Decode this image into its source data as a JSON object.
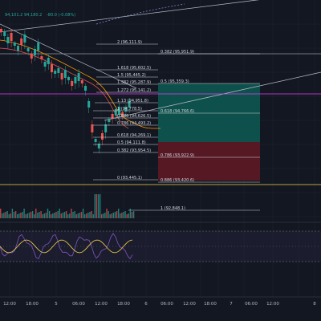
{
  "header": {
    "values": [
      {
        "text": "94,101.2",
        "color": "#26a69a"
      },
      {
        "text": "94,180.2",
        "color": "#26a69a"
      },
      {
        "text": "-80.0 (-0.08%)",
        "color": "#26a69a"
      }
    ]
  },
  "colors": {
    "background": "#131722",
    "up": "#26a69a",
    "down": "#ef5350",
    "fib_line": "#d1d4dc",
    "target_zone": "#0e5a52",
    "stop_zone": "#5e1a25",
    "oscillator": "#7e57c2",
    "oscillator_signal": "#f5d14a"
  },
  "fib_extension": [
    {
      "label": "2 (96,111.9)"
    },
    {
      "label": "1.618 (95,602.5)"
    },
    {
      "label": "1.5 (95,445.2)"
    },
    {
      "label": "1.382 (95,287.9)"
    },
    {
      "label": "1.272 (95,141.2)"
    },
    {
      "label": "1.13 (94,951.8)"
    },
    {
      "label": "1 (94,778.5)"
    },
    {
      "label": "0.886 (94,626.5)"
    },
    {
      "label": "0.786 (94,493.2)"
    },
    {
      "label": "0.618 (94,269.1)"
    },
    {
      "label": "0.5 (94,111.8)"
    },
    {
      "label": "0.382 (93,954.5)"
    },
    {
      "label": "0 (93,445.1)"
    },
    {
      "label": "1 (92,848.1)"
    }
  ],
  "fib_retracement": [
    {
      "label": "0.382 (95,951.9)"
    },
    {
      "label": "0.5 (95,359.3)"
    },
    {
      "label": "0.618 (94,766.6)"
    },
    {
      "label": "0.786 (93,922.9)"
    },
    {
      "label": "0.886 (93,420.6)"
    }
  ],
  "time_axis": {
    "labels": [
      "12:00",
      "18:00",
      "5",
      "06:00",
      "12:00",
      "18:00",
      "6",
      "06:00",
      "12:00",
      "18:00",
      "7",
      "06:00",
      "12:00",
      "8"
    ]
  }
}
